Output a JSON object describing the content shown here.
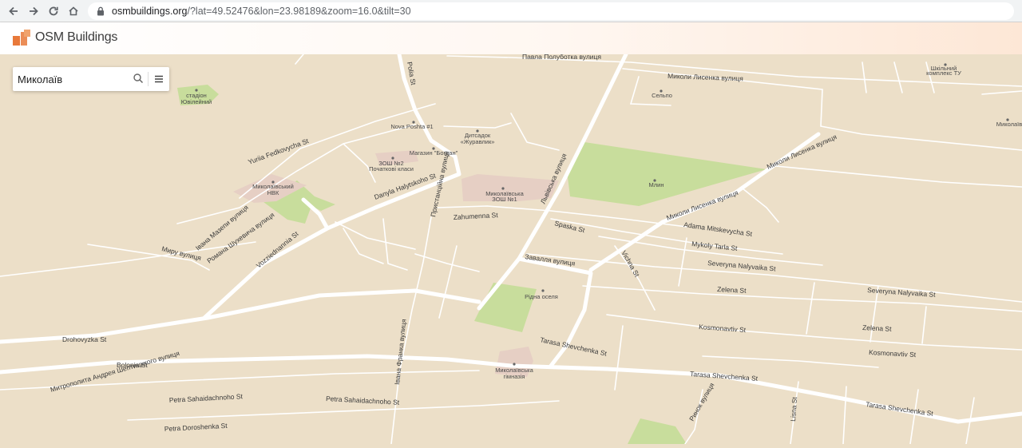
{
  "browser": {
    "url_host": "osmbuildings.org",
    "url_rest": "/?lat=49.52476&lon=23.98189&zoom=16.0&tilt=30",
    "back_icon": "arrow-left-icon",
    "forward_icon": "arrow-right-icon",
    "reload_icon": "reload-icon",
    "home_icon": "home-icon",
    "lock_icon": "lock-icon"
  },
  "header": {
    "logo_text": "OSM Buildings",
    "brand_color": "#e8793a"
  },
  "search": {
    "value": "Миколаїв",
    "search_icon": "search-icon",
    "menu_icon": "menu-icon"
  },
  "map": {
    "colors": {
      "land": "#ecdfc8",
      "road": "#ffffff",
      "park": "#c8dd9c",
      "building": "#e6cfc4",
      "label": "#3a3a3a"
    },
    "streets": {
      "drohovyzka": "Drohovyzka St",
      "sheptytskoho": "Митрополита Андрея Шептицького вулиця",
      "bolonia": "Bolonia St",
      "sahaidachnoho_1": "Petra Sahaidachnoho St",
      "sahaidachnoho_2": "Petra Sahaidachnoho St",
      "doroshenka": "Petra Doroshenka St",
      "franka": "Івана Франка вулиця",
      "shevchenka_1": "Tarasa Shevchenka St",
      "shevchenka_2": "Tarasa Shevchenka St",
      "shevchenka_3": "Tarasa Shevchenka St",
      "zavalia": "Завалля вулиця",
      "zahumenna": "Zahumenna St",
      "spaska": "Spaska St",
      "lvivska": "Львівська вулиця",
      "halytskoho": "Danyla Halytskoho St",
      "prystaniina": "Пристанційна вулиця",
      "vozziednannia": "Vozziednannia St",
      "myru": "Миру вулиця",
      "mazepy": "Івана Мазепи вулиця",
      "shukhevycha": "Романа Шухевича вулиця",
      "fedkovycha": "Yuriia Fedkovycha St",
      "polubotka": "Павла Полуботка вулиця",
      "lysenka_1": "Миколи Лисенка вулиця",
      "lysenka_2": "Миколи Лисенка вулиця",
      "lysenka_3": "Миколи Лисенка вулиця",
      "mitskevycha": "Adama Mitskevycha St",
      "tarla": "Mykoly Tarla St",
      "nalyvaika_1": "Severyna Nalyvaika St",
      "nalyvaika_2": "Severyna Nalyvaika St",
      "zelena_1": "Zelena St",
      "zelena_2": "Zelena St",
      "kosmonavtiv_1": "Kosmonavtiv St",
      "kosmonavtiv_2": "Kosmonavtiv St",
      "vichna": "Vichna St",
      "rynok": "Ринок вулиця",
      "lisna": "Lisna St",
      "polia": "Polia St"
    },
    "pois": {
      "stadium_1": "стадіон",
      "stadium_2": "Ювілейний",
      "nova_poshta": "Nova Poshta #1",
      "kindergarten_1": "Дитсадок",
      "kindergarten_2": "«Журавлик»",
      "shop": "Магазин \"Богдан\"",
      "school2_1": "ЗОШ №2",
      "school2_2": "Початкові класи",
      "nvk_1": "Миколаївський",
      "nvk_2": "НВК",
      "school1_1": "Миколаївська",
      "school1_2": "ЗОШ №1",
      "mlyn": "Млин",
      "ridna_oselia": "Рідна оселя",
      "gymnasium_1": "Миколаївська",
      "gymnasium_2": "гімназія",
      "selpo": "Сельпо",
      "complex_1": "Шкільний",
      "complex_2": "комплекс ТУ",
      "mykolaiv_edge": "Миколаїв"
    }
  }
}
